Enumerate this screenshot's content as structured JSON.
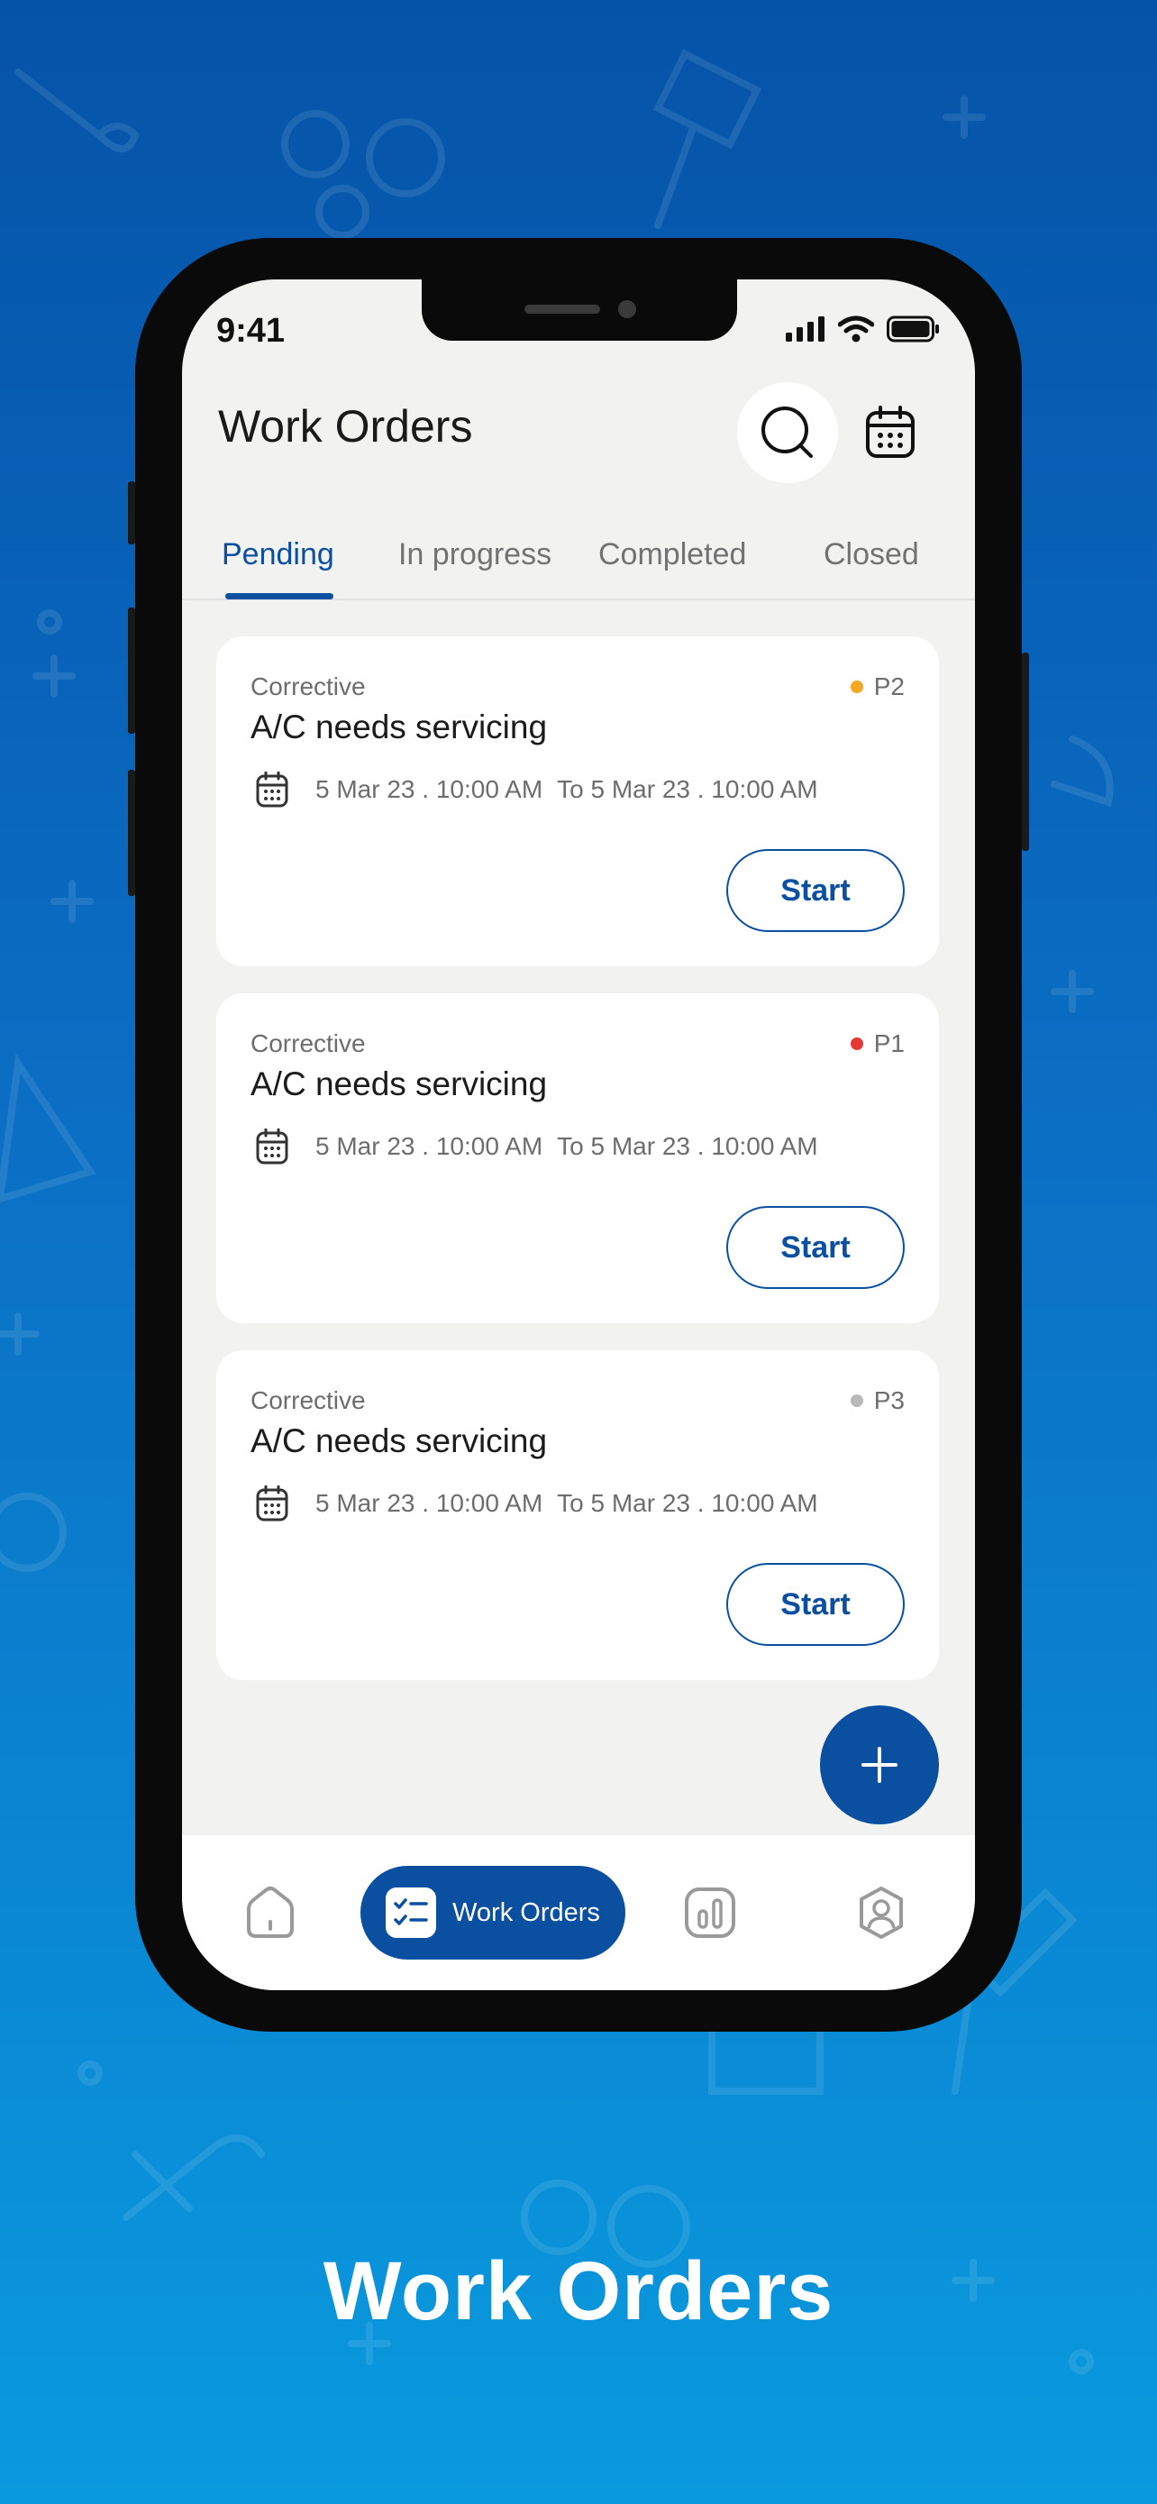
{
  "status_bar": {
    "time": "9:41"
  },
  "header": {
    "title": "Work Orders"
  },
  "tabs": [
    {
      "label": "Pending",
      "active": true
    },
    {
      "label": "In progress",
      "active": false
    },
    {
      "label": "Completed",
      "active": false
    },
    {
      "label": "Closed",
      "active": false
    }
  ],
  "work_orders": [
    {
      "type": "Corrective",
      "title": "A/C needs servicing",
      "priority": "P2",
      "priority_color": "#f5a623",
      "start": "5 Mar 23 . 10:00 AM",
      "end": "To 5 Mar 23 . 10:00 AM",
      "action": "Start"
    },
    {
      "type": "Corrective",
      "title": "A/C needs servicing",
      "priority": "P1",
      "priority_color": "#e53935",
      "start": "5 Mar 23 . 10:00 AM",
      "end": "To 5 Mar 23 . 10:00 AM",
      "action": "Start"
    },
    {
      "type": "Corrective",
      "title": "A/C needs servicing",
      "priority": "P3",
      "priority_color": "#b9b9b9",
      "start": "5 Mar 23 . 10:00 AM",
      "end": "To 5 Mar 23 . 10:00 AM",
      "action": "Start"
    }
  ],
  "bottom_nav": {
    "items": [
      {
        "icon": "home-icon"
      },
      {
        "icon": "work-orders-icon",
        "label": "Work Orders",
        "active": true
      },
      {
        "icon": "reports-icon"
      },
      {
        "icon": "profile-icon"
      }
    ]
  },
  "caption": "Work Orders",
  "colors": {
    "accent": "#0b4fa1",
    "screen_bg": "#f2f3f1",
    "bg_top": "#0553a8",
    "bg_bottom": "#0a9ade"
  }
}
